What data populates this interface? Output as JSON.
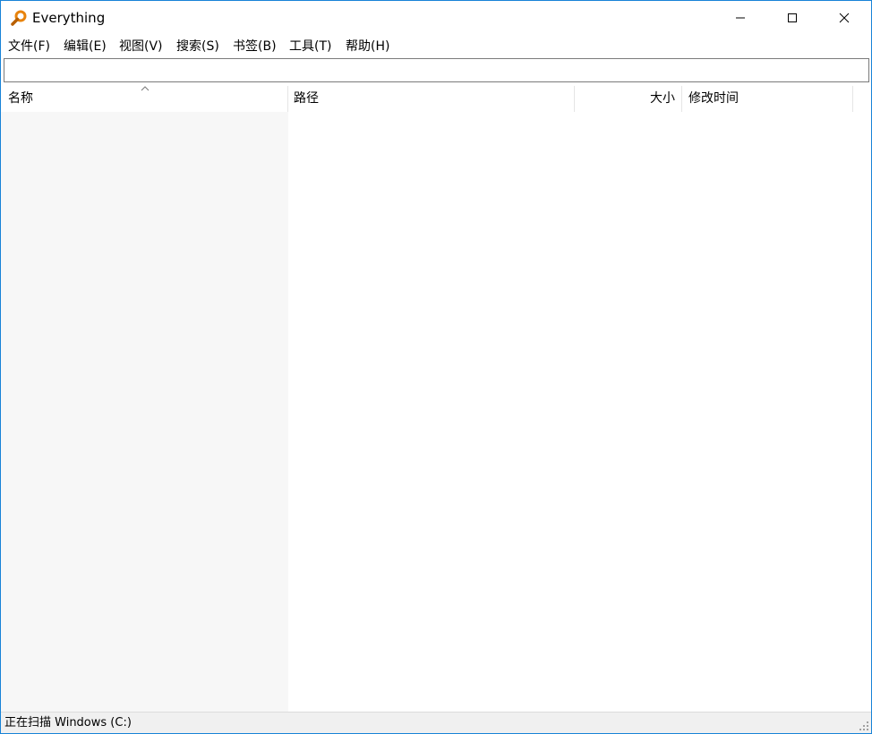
{
  "app": {
    "title": "Everything"
  },
  "menu": [
    {
      "label": "文件(F)"
    },
    {
      "label": "编辑(E)"
    },
    {
      "label": "视图(V)"
    },
    {
      "label": "搜索(S)"
    },
    {
      "label": "书签(B)"
    },
    {
      "label": "工具(T)"
    },
    {
      "label": "帮助(H)"
    }
  ],
  "search": {
    "value": "",
    "placeholder": ""
  },
  "columns": {
    "name": "名称",
    "path": "路径",
    "size": "大小",
    "modified": "修改时间"
  },
  "status": {
    "text": "正在扫描 Windows (C:)"
  },
  "colors": {
    "accent": "#1883d7",
    "icon": "#e8830c",
    "name_column_bg": "#f7f7f7",
    "status_bg": "#f0f0f0"
  },
  "icons": [
    "magnifier-app-icon",
    "minimize-icon",
    "maximize-icon",
    "close-icon",
    "sort-ascending-icon",
    "resize-grip-icon"
  ]
}
